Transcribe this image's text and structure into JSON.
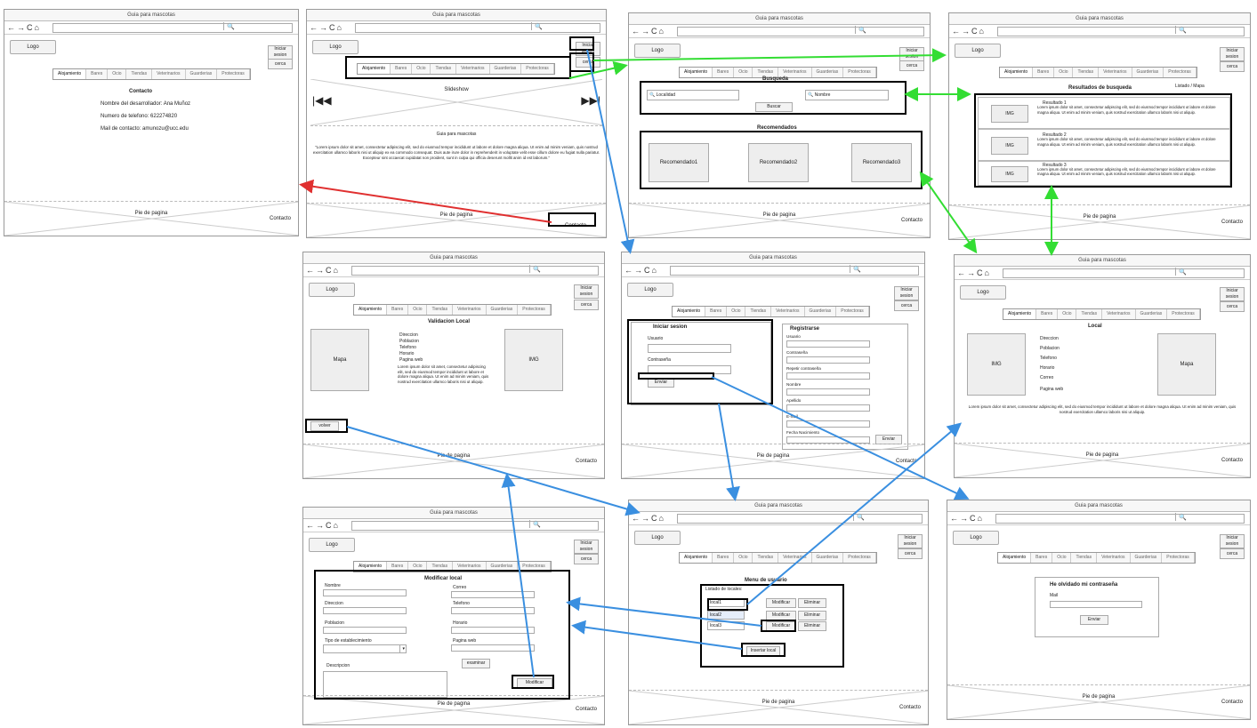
{
  "common": {
    "title": "Guia para mascotas",
    "logo": "Logo",
    "login_btn": "Iniciar sesion",
    "cerca_btn": "cerca",
    "footer": "Pie de pagina",
    "contact": "Contacto",
    "tabs": [
      "Alojamiento",
      "Bares",
      "Ocio",
      "Tiendas",
      "Veterinarios",
      "Guarderias",
      "Protectoras"
    ]
  },
  "contact_page": {
    "heading": "Contacto",
    "dev": "Nombre del desarrollador: Ana Muñoz",
    "phone": "Numero de telefono: 622274820",
    "mail": "Mail de contacto: amunozu@ucc.edu"
  },
  "home_page": {
    "slideshow": "Slideshow",
    "subtitle": "Guia para mascotas",
    "lorem": "\"Lorem ipsum dolor sit amet, consectetur adipiscing elit, sed do eiusmod tempor incididunt ut labore et dolore magna aliqua. Ut enim ad minim veniam, quis nostrud exercitation ullamco laboris nisi ut aliquip ex ea commodo consequat. Duis aute irure dolor in reprehenderit in voluptate velit esse cillum dolore eu fugiat nulla pariatur. Excepteur sint occaecat cupidatat non proident, sunt in culpa qui officia deserunt mollit anim id est laborum.\""
  },
  "search_page": {
    "busqueda": "Busqueda",
    "localidad": "Localidad",
    "nombre": "Nombre",
    "buscar": "Buscar",
    "recomendados": "Recomendados",
    "recs": [
      "Recomendado1",
      "Recomendado2",
      "Recomendado3"
    ]
  },
  "results_page": {
    "heading": "Resultados de busqueda",
    "toggle": "Listado / Mapa",
    "img": "IMG",
    "results": [
      {
        "title": "Resultado 1",
        "text": "Lorem ipsum dolor sit amet, consectetur adipiscing elit, sed do eiusmod tempor incididunt ut labore et dolore magna aliqua. Ut enim ad minim veniam, quis nostrud exercitation ullamco laboris nisi ut aliquip."
      },
      {
        "title": "Resultado 2",
        "text": "Lorem ipsum dolor sit amet, consectetur adipiscing elit, sed do eiusmod tempor incididunt ut labore et dolore magna aliqua. Ut enim ad minim veniam, quis nostrud exercitation ullamco laboris nisi ut aliquip."
      },
      {
        "title": "Resultado 3",
        "text": "Lorem ipsum dolor sit amet, consectetur adipiscing elit, sed do eiusmod tempor incididunt ut labore et dolore magna aliqua. Ut enim ad minim veniam, quis nostrud exercitation ullamco laboris nisi ut aliquip."
      }
    ]
  },
  "validation_page": {
    "heading": "Validacion Local",
    "mapa": "Mapa",
    "img": "IMG",
    "fields": [
      "Direccion",
      "Poblacion",
      "Telefono",
      "Horario",
      "Pagina web"
    ],
    "lorem": "Lorem ipsum dolor sit amet, consectetur adipiscing elit, sed do eiusmod tempor incididunt ut labore et dolore magna aliqua. Ut enim ad minim veniam, quis nostrud exercitation ullamco laboris nisi ut aliquip.",
    "back": "volver"
  },
  "login_page": {
    "login_heading": "Iniciar sesion",
    "usuario": "Usuario",
    "contrasena": "Contraseña",
    "enviar": "Enviar",
    "register_heading": "Registrarse",
    "reg_fields": [
      "Usuario",
      "Contraseña",
      "Repetir contraseña",
      "Nombre",
      "Apellido",
      "E-mail",
      "Fecha Nacimiento"
    ],
    "reg_send": "Enviar"
  },
  "local_page": {
    "heading": "Local",
    "img": "IMG",
    "mapa": "Mapa",
    "fields": [
      "Direccion",
      "Poblacion",
      "Telefono",
      "Horario",
      "Correo",
      "Pagina web"
    ],
    "lorem": "Lorem ipsum dolor sit amet, consectetur adipiscing elit, sed do eiusmod tempor incididunt ut labore et dolore magna aliqua. Ut enim ad minim veniam, quis nostrud exercitation ullamco laboris nisi ut aliquip."
  },
  "modify_page": {
    "heading": "Modificar local",
    "left_fields": [
      "Nombre",
      "Direccion",
      "Poblacion",
      "Tipo de establecimiento"
    ],
    "right_fields": [
      "Correo",
      "Telefono",
      "Horario",
      "Pagina web"
    ],
    "examinar": "examinar",
    "descripcion": "Descripcion",
    "modificar": "Modificar"
  },
  "menu_page": {
    "heading": "Menu de usuario",
    "list_label": "Listado de locales:",
    "locals": [
      "local1",
      "local2",
      "local3"
    ],
    "modificar": "Modificar",
    "eliminar": "Eliminar",
    "insert": "Insertar local"
  },
  "forgot_page": {
    "heading": "He olvidado mi contraseña",
    "mail": "Mail",
    "send": "Enviar"
  },
  "colors": {
    "green_arrow": "#33dd33",
    "blue_arrow": "#3a8fe0",
    "red_arrow": "#e03030"
  }
}
